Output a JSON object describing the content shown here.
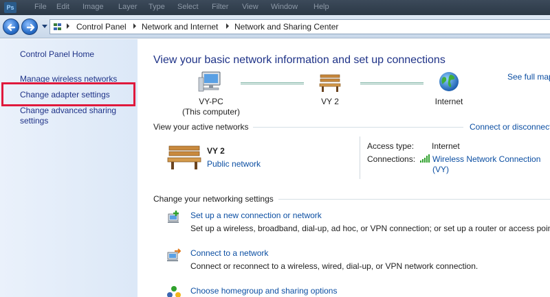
{
  "topstrip": {
    "logo": "Ps",
    "menus": [
      "File",
      "Edit",
      "Image",
      "Layer",
      "Type",
      "Select",
      "Filter",
      "View",
      "Window",
      "Help"
    ]
  },
  "address": {
    "crumbs": [
      "Control Panel",
      "Network and Internet",
      "Network and Sharing Center"
    ]
  },
  "left_pane": {
    "home": "Control Panel Home",
    "items": [
      "Manage wireless networks",
      "Change adapter settings",
      "Change advanced sharing settings"
    ],
    "highlight_color": "#e0193c"
  },
  "main": {
    "title": "View your basic network information and set up connections",
    "see_full_map": "See full map",
    "map": {
      "computer_name": "VY-PC",
      "computer_sub": "(This computer)",
      "network": "VY  2",
      "internet": "Internet"
    },
    "active": {
      "label": "View your active networks",
      "connect_link": "Connect or disconnect",
      "name": "VY  2",
      "type": "Public network",
      "access_label": "Access type:",
      "access_value": "Internet",
      "connections_label": "Connections:",
      "connection_line1": "Wireless Network Connection",
      "connection_line2": "(VY)"
    },
    "settings_label": "Change your networking settings",
    "tasks": [
      {
        "link": "Set up a new connection or network",
        "desc": "Set up a wireless, broadband, dial-up, ad hoc, or VPN connection; or set up a router or access point."
      },
      {
        "link": "Connect to a network",
        "desc": "Connect or reconnect to a wireless, wired, dial-up, or VPN network connection."
      },
      {
        "link": "Choose homegroup and sharing options",
        "desc": ""
      }
    ]
  },
  "colors": {
    "link": "#0b4ea2",
    "heading": "#1e3287",
    "left_pane_bg": "#dce8f7"
  }
}
